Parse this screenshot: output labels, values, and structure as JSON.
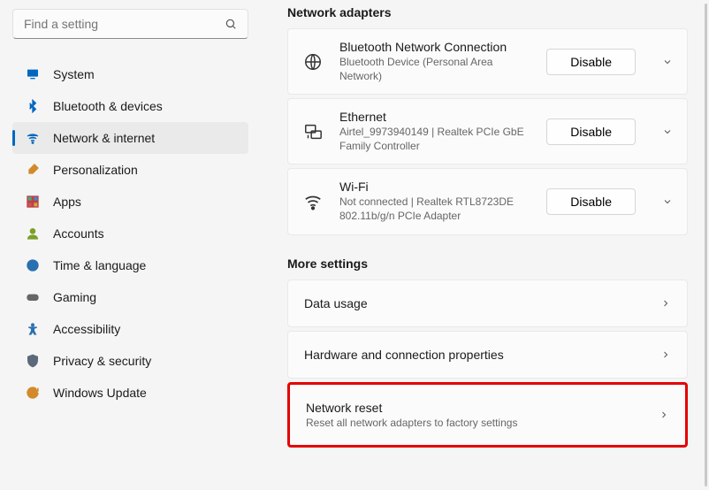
{
  "search": {
    "placeholder": "Find a setting"
  },
  "sidebar": {
    "items": [
      {
        "label": "System",
        "icon": "monitor-icon",
        "color": "#0067c0"
      },
      {
        "label": "Bluetooth & devices",
        "icon": "bluetooth-icon",
        "color": "#0067c0"
      },
      {
        "label": "Network & internet",
        "icon": "wifi-icon",
        "color": "#0067c0",
        "selected": true
      },
      {
        "label": "Personalization",
        "icon": "brush-icon",
        "color": "#d28a2a"
      },
      {
        "label": "Apps",
        "icon": "apps-icon",
        "color": "#c04040"
      },
      {
        "label": "Accounts",
        "icon": "person-icon",
        "color": "#7aa02a"
      },
      {
        "label": "Time & language",
        "icon": "globe-icon",
        "color": "#2a6fb0"
      },
      {
        "label": "Gaming",
        "icon": "gamepad-icon",
        "color": "#666666"
      },
      {
        "label": "Accessibility",
        "icon": "accessibility-icon",
        "color": "#2a6fb0"
      },
      {
        "label": "Privacy & security",
        "icon": "shield-icon",
        "color": "#5a6a7a"
      },
      {
        "label": "Windows Update",
        "icon": "update-icon",
        "color": "#d28a2a"
      }
    ]
  },
  "adapters_section_title": "Network adapters",
  "adapters": [
    {
      "icon": "globe-network-icon",
      "title": "Bluetooth Network Connection",
      "subtitle": "Bluetooth Device (Personal Area Network)",
      "button": "Disable"
    },
    {
      "icon": "ethernet-icon",
      "title": "Ethernet",
      "subtitle": "Airtel_9973940149 | Realtek PCIe GbE Family Controller",
      "button": "Disable"
    },
    {
      "icon": "wifi-waves-icon",
      "title": "Wi-Fi",
      "subtitle": "Not connected | Realtek RTL8723DE 802.11b/g/n PCIe Adapter",
      "button": "Disable"
    }
  ],
  "more_section_title": "More settings",
  "more_rows": [
    {
      "title": "Data usage"
    },
    {
      "title": "Hardware and connection properties"
    },
    {
      "title": "Network reset",
      "subtitle": "Reset all network adapters to factory settings",
      "highlighted": true
    }
  ]
}
